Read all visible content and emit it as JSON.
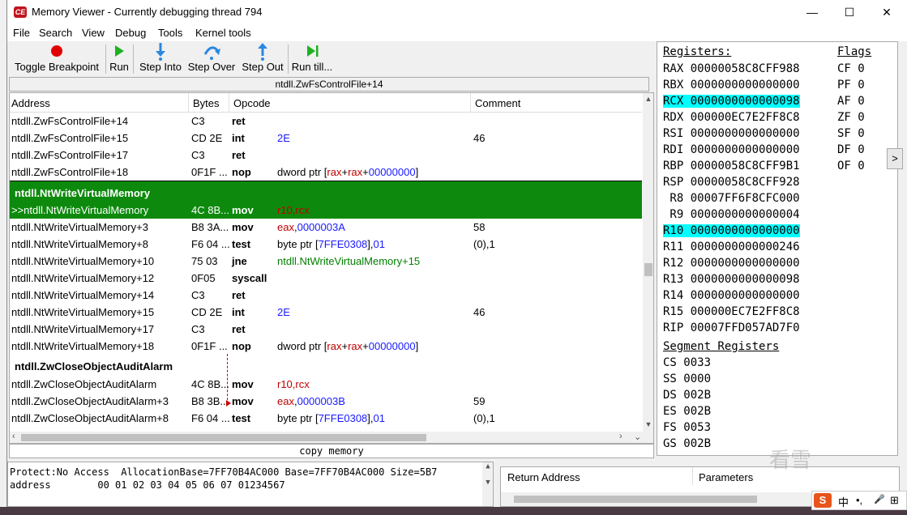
{
  "window": {
    "title": "Memory Viewer - Currently debugging thread 794",
    "minimize": "—",
    "maximize": "☐",
    "close": "✕"
  },
  "menu": [
    "File",
    "Search",
    "View",
    "Debug",
    "Tools",
    "Kernel tools"
  ],
  "toolbar": {
    "toggle_breakpoint": "Toggle Breakpoint",
    "run": "Run",
    "step_into": "Step Into",
    "step_over": "Step Over",
    "step_out": "Step Out",
    "run_till": "Run till..."
  },
  "disasm": {
    "header": "ntdll.ZwFsControlFile+14",
    "columns": {
      "address": "Address",
      "bytes": "Bytes",
      "opcode": "Opcode",
      "comment": "Comment"
    },
    "rows": [
      {
        "addr": "ntdll.ZwFsControlFile+14",
        "bytes": "C3",
        "op": "ret",
        "args": "",
        "cmt": ""
      },
      {
        "addr": "ntdll.ZwFsControlFile+15",
        "bytes": "CD 2E",
        "op": "int",
        "args": "2E",
        "cmt": "46"
      },
      {
        "addr": "ntdll.ZwFsControlFile+17",
        "bytes": "C3",
        "op": "ret",
        "args": "",
        "cmt": ""
      },
      {
        "addr": "ntdll.ZwFsControlFile+18",
        "bytes": "0F1F ...",
        "op": "nop",
        "args_prefix": "dword ptr [",
        "args_reg1": "rax",
        "args_plus1": "+",
        "args_reg2": "rax",
        "args_plus2": "+",
        "args_num": "00000000",
        "args_suffix": "]",
        "cmt": ""
      },
      {
        "label": "ntdll.NtWriteVirtualMemory"
      },
      {
        "addr": ">>ntdll.NtWriteVirtualMemory",
        "bytes": "4C 8B...",
        "op": "mov",
        "args_reg1": "r10",
        "args_comma": ",",
        "args_reg2": "rcx",
        "cmt": ""
      },
      {
        "addr": "ntdll.NtWriteVirtualMemory+3",
        "bytes": "B8 3A...",
        "op": "mov",
        "args_reg1": "eax",
        "args_comma": ",",
        "args_num": "0000003A",
        "cmt": "58"
      },
      {
        "addr": "ntdll.NtWriteVirtualMemory+8",
        "bytes": "F6 04 ...",
        "op": "test",
        "args_prefix": "byte ptr [",
        "args_num": "7FFE0308",
        "args_suffix": "],",
        "args_num2": "01",
        "cmt": "(0),1"
      },
      {
        "addr": "ntdll.NtWriteVirtualMemory+10",
        "bytes": "75 03",
        "op": "jne",
        "args_sym": "ntdll.NtWriteVirtualMemory+15",
        "cmt": ""
      },
      {
        "addr": "ntdll.NtWriteVirtualMemory+12",
        "bytes": "0F05",
        "op": "syscall",
        "args": "",
        "cmt": ""
      },
      {
        "addr": "ntdll.NtWriteVirtualMemory+14",
        "bytes": "C3",
        "op": "ret",
        "args": "",
        "cmt": ""
      },
      {
        "addr": "ntdll.NtWriteVirtualMemory+15",
        "bytes": "CD 2E",
        "op": "int",
        "args": "2E",
        "cmt": "46"
      },
      {
        "addr": "ntdll.NtWriteVirtualMemory+17",
        "bytes": "C3",
        "op": "ret",
        "args": "",
        "cmt": ""
      },
      {
        "addr": "ntdll.NtWriteVirtualMemory+18",
        "bytes": "0F1F ...",
        "op": "nop",
        "args_prefix": "dword ptr [",
        "args_reg1": "rax",
        "args_plus1": "+",
        "args_reg2": "rax",
        "args_plus2": "+",
        "args_num": "00000000",
        "args_suffix": "]",
        "cmt": ""
      },
      {
        "label": "ntdll.ZwCloseObjectAuditAlarm"
      },
      {
        "addr": "ntdll.ZwCloseObjectAuditAlarm",
        "bytes": "4C 8B...",
        "op": "mov",
        "args_reg1": "r10",
        "args_comma": ",",
        "args_reg2": "rcx",
        "cmt": ""
      },
      {
        "addr": "ntdll.ZwCloseObjectAuditAlarm+3",
        "bytes": "B8 3B...",
        "op": "mov",
        "args_reg1": "eax",
        "args_comma": ",",
        "args_num": "0000003B",
        "cmt": "59"
      },
      {
        "addr": "ntdll.ZwCloseObjectAuditAlarm+8",
        "bytes": "F6 04 ...",
        "op": "test",
        "args_prefix": "byte ptr [",
        "args_num": "7FFE0308",
        "args_suffix": "],",
        "args_num2": "01",
        "cmt": "(0),1"
      }
    ],
    "copy_memory": "copy memory"
  },
  "registers": {
    "title": "Registers:",
    "flags_title": "Flags",
    "segment_title": "Segment Registers",
    "list": [
      {
        "name": "RAX",
        "value": "00000058C8CFF988"
      },
      {
        "name": "RBX",
        "value": "0000000000000000"
      },
      {
        "name": "RCX",
        "value": "0000000000000098"
      },
      {
        "name": "RDX",
        "value": "000000EC7E2FF8C8"
      },
      {
        "name": "RSI",
        "value": "0000000000000000"
      },
      {
        "name": "RDI",
        "value": "0000000000000000"
      },
      {
        "name": "RBP",
        "value": "00000058C8CFF9B1"
      },
      {
        "name": "RSP",
        "value": "00000058C8CFF928"
      },
      {
        "name": " R8",
        "value": "00007FF6F8CFC000"
      },
      {
        "name": " R9",
        "value": "0000000000000004"
      },
      {
        "name": "R10",
        "value": "0000000000000000"
      },
      {
        "name": "R11",
        "value": "0000000000000246"
      },
      {
        "name": "R12",
        "value": "0000000000000000"
      },
      {
        "name": "R13",
        "value": "0000000000000098"
      },
      {
        "name": "R14",
        "value": "0000000000000000"
      },
      {
        "name": "R15",
        "value": "000000EC7E2FF8C8"
      },
      {
        "name": "RIP",
        "value": "00007FFD057AD7F0"
      }
    ],
    "flags": [
      {
        "name": "CF",
        "value": "0"
      },
      {
        "name": "PF",
        "value": "0"
      },
      {
        "name": "AF",
        "value": "0"
      },
      {
        "name": "ZF",
        "value": "0"
      },
      {
        "name": "SF",
        "value": "0"
      },
      {
        "name": "DF",
        "value": "0"
      },
      {
        "name": "OF",
        "value": "0"
      }
    ],
    "segments": [
      {
        "name": "CS",
        "value": "0033"
      },
      {
        "name": "SS",
        "value": "0000"
      },
      {
        "name": "DS",
        "value": "002B"
      },
      {
        "name": "ES",
        "value": "002B"
      },
      {
        "name": "FS",
        "value": "0053"
      },
      {
        "name": "GS",
        "value": "002B"
      }
    ],
    "expand_button": ">",
    "highlight_color": "#00ffff"
  },
  "hexview": {
    "line1": "Protect:No Access  AllocationBase=7FF70B4AC000 Base=7FF70B4AC000 Size=5B7",
    "line2": "address        00 01 02 03 04 05 06 07 01234567"
  },
  "stack": {
    "return_address": "Return Address",
    "parameters": "Parameters"
  },
  "watermark": "看雪",
  "ime": {
    "s": "S",
    "lang": "中",
    "punct": "•,",
    "mic": "🎤",
    "grid": "⊞"
  },
  "colors": {
    "selected_row": "#0d8a0d",
    "register_text": "#c00000",
    "number_text": "#1a1aff",
    "symbol_text": "#008000"
  }
}
